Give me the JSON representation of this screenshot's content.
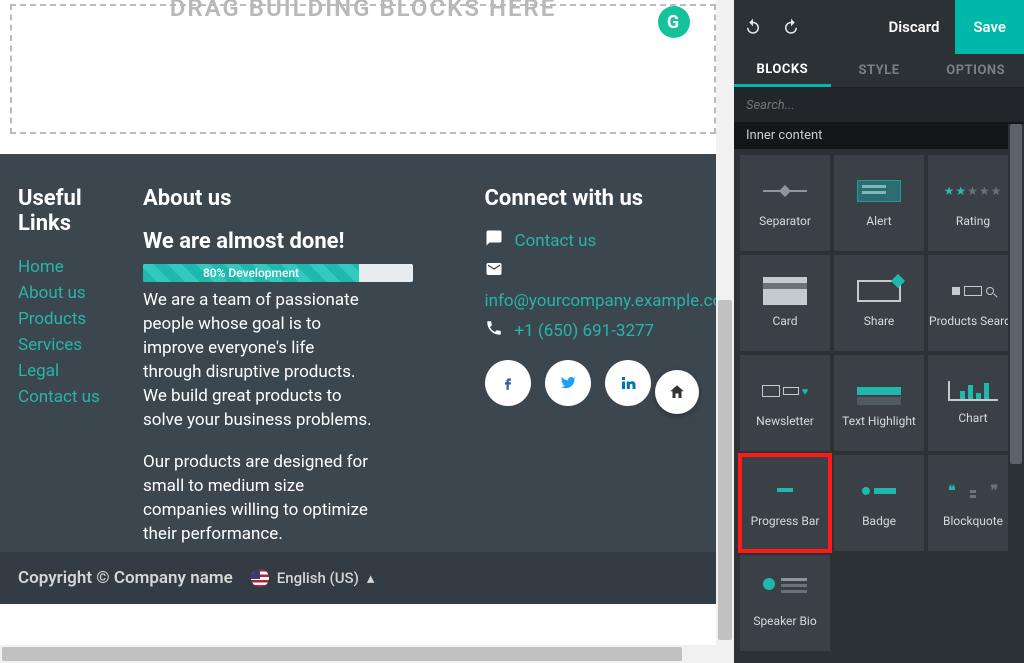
{
  "canvas": {
    "dropzone_label": "DRAG BUILDING BLOCKS HERE",
    "grammarly_badge": "G"
  },
  "footer": {
    "useful_links": {
      "title": "Useful Links",
      "items": [
        "Home",
        "About us",
        "Products",
        "Services",
        "Legal",
        "Contact us"
      ]
    },
    "about": {
      "title": "About us",
      "subtitle": "We are almost done!",
      "progress_label": "80% Development",
      "progress_percent": 80,
      "paragraph1": "We are a team of passionate people whose goal is to improve everyone's life through disruptive products. We build great products to solve your business problems.",
      "paragraph2": "Our products are designed for small to medium size companies willing to optimize their performance."
    },
    "connect": {
      "title": "Connect with us",
      "contact_label": "Contact us",
      "email": "info@yourcompany.example.com",
      "phone": "+1 (650) 691-3277",
      "social": [
        "facebook",
        "twitter",
        "linkedin"
      ]
    },
    "copyright": "Copyright © Company name",
    "language": "English (US)"
  },
  "panel": {
    "toolbar": {
      "discard": "Discard",
      "save": "Save"
    },
    "tabs": {
      "blocks": "BLOCKS",
      "style": "STYLE",
      "options": "OPTIONS"
    },
    "search_placeholder": "Search...",
    "section_title": "Inner content",
    "blocks": [
      {
        "id": "separator",
        "label": "Separator"
      },
      {
        "id": "alert",
        "label": "Alert"
      },
      {
        "id": "rating",
        "label": "Rating"
      },
      {
        "id": "card",
        "label": "Card"
      },
      {
        "id": "share",
        "label": "Share"
      },
      {
        "id": "products-search",
        "label": "Products Search"
      },
      {
        "id": "newsletter",
        "label": "Newsletter"
      },
      {
        "id": "text-highlight",
        "label": "Text Highlight"
      },
      {
        "id": "chart",
        "label": "Chart"
      },
      {
        "id": "progress-bar",
        "label": "Progress Bar"
      },
      {
        "id": "badge",
        "label": "Badge"
      },
      {
        "id": "blockquote",
        "label": "Blockquote"
      },
      {
        "id": "speaker-bio",
        "label": "Speaker Bio"
      }
    ],
    "highlighted_block": "progress-bar"
  },
  "colors": {
    "accent": "#00b8a9",
    "link": "#26b5a8"
  }
}
